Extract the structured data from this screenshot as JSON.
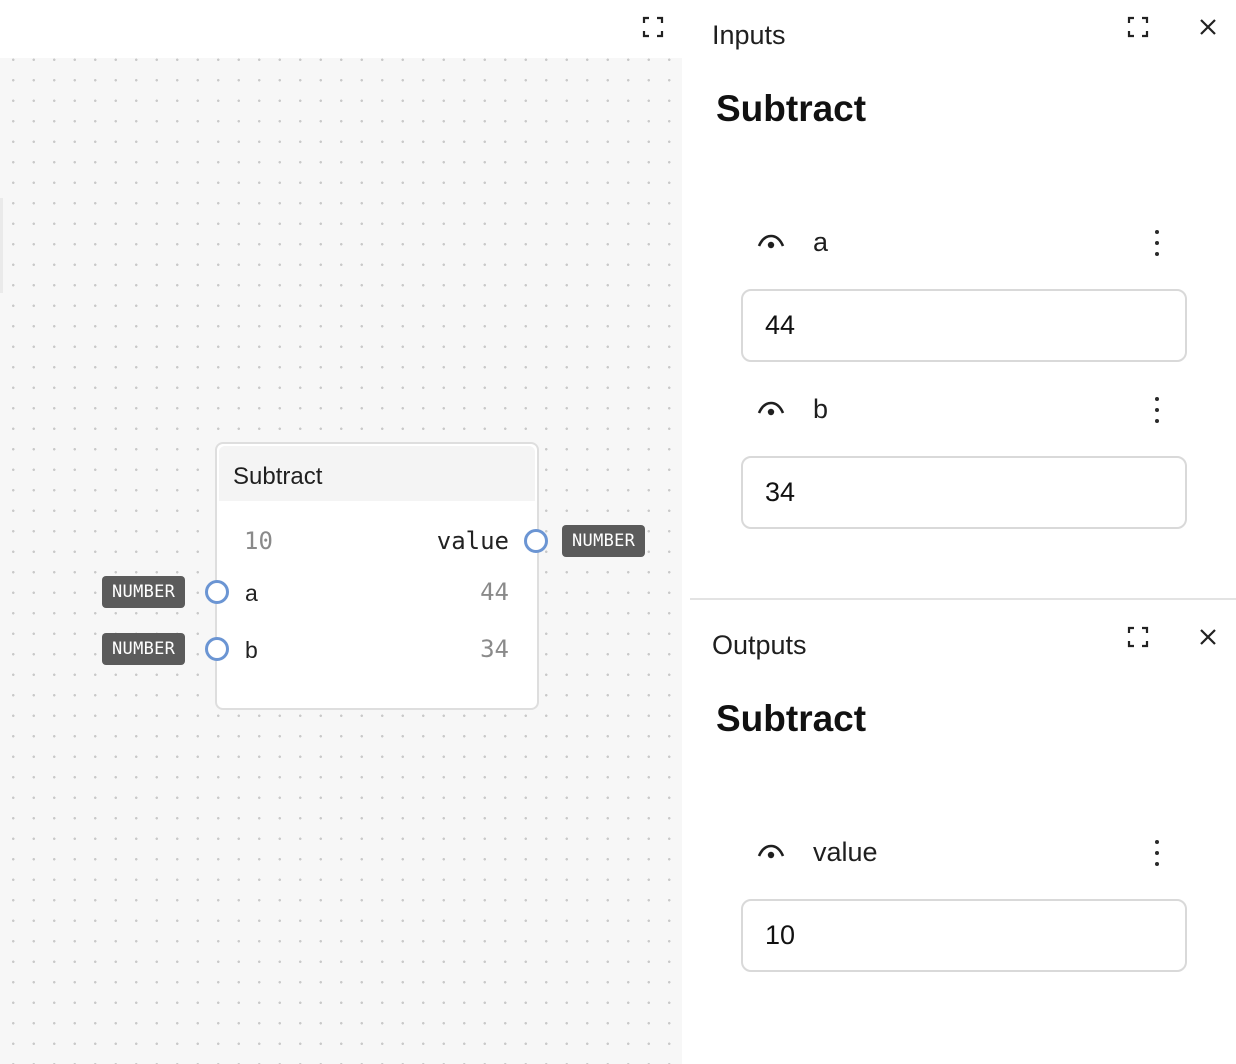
{
  "canvas": {
    "node": {
      "title": "Subtract",
      "output": {
        "value": "10",
        "name": "value",
        "type": "NUMBER"
      },
      "inputs": [
        {
          "name": "a",
          "value": "44",
          "type": "NUMBER"
        },
        {
          "name": "b",
          "value": "34",
          "type": "NUMBER"
        }
      ]
    }
  },
  "inputs_panel": {
    "label": "Inputs",
    "heading": "Subtract",
    "fields": [
      {
        "name": "a",
        "value": "44"
      },
      {
        "name": "b",
        "value": "34"
      }
    ]
  },
  "outputs_panel": {
    "label": "Outputs",
    "heading": "Subtract",
    "fields": [
      {
        "name": "value",
        "value": "10"
      }
    ]
  },
  "icons": {
    "expand": "expand-icon",
    "close": "close-icon",
    "visibility": "eye-icon",
    "more": "more-vertical-icon"
  },
  "colors": {
    "port_border": "#6b95d3",
    "badge_bg": "#5b5b5b",
    "canvas_bg": "#f7f7f7"
  }
}
